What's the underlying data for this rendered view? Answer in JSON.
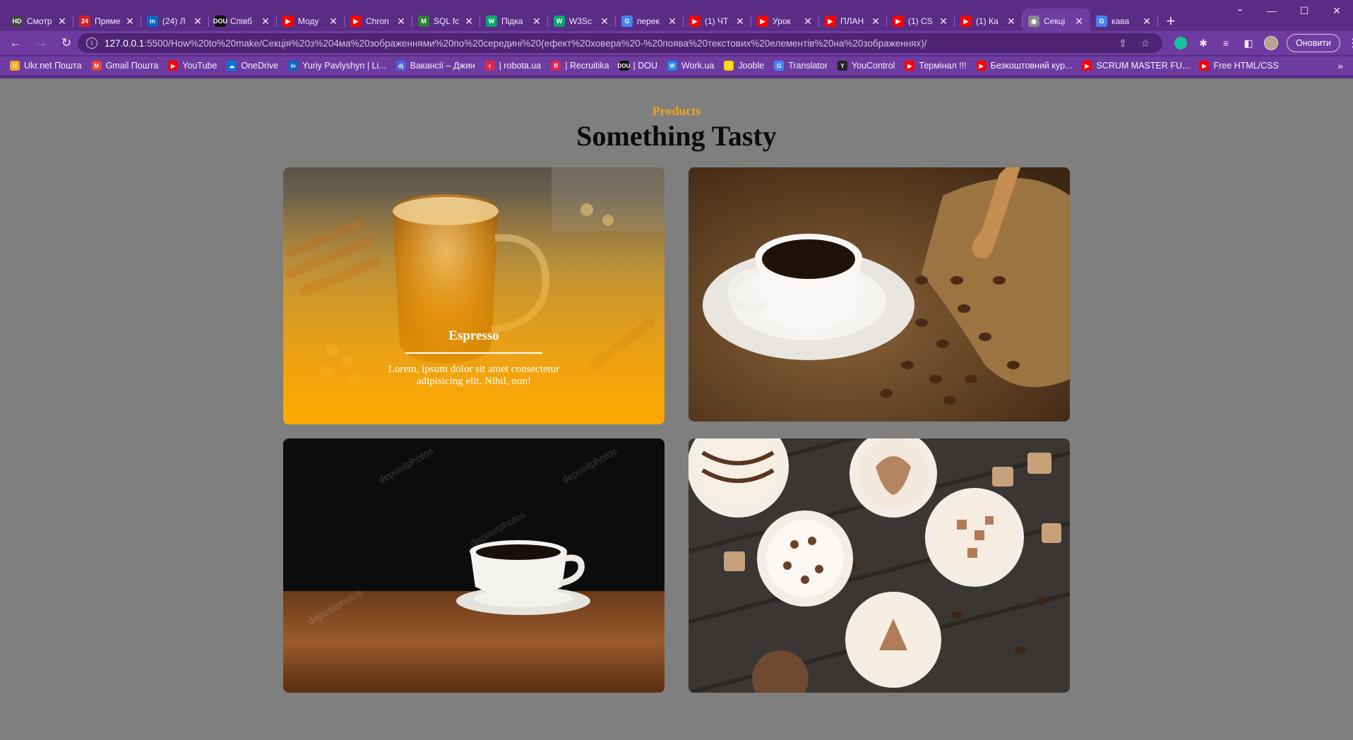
{
  "browser": {
    "tabs": [
      {
        "title": "Смотр",
        "icon_color": "#444444",
        "icon_text": "HD"
      },
      {
        "title": "Пряме",
        "icon_color": "#d32027",
        "icon_text": "24"
      },
      {
        "title": "(24) Л",
        "icon_color": "#0a66c2",
        "icon_text": "in"
      },
      {
        "title": "Співб",
        "icon_color": "#111111",
        "icon_text": "DOU"
      },
      {
        "title": "Моду",
        "icon_color": "#ff0000",
        "icon_text": "▶"
      },
      {
        "title": "Chron",
        "icon_color": "#ff0000",
        "icon_text": "▶"
      },
      {
        "title": "SQL fc",
        "icon_color": "#2e7d32",
        "icon_text": "M"
      },
      {
        "title": "Підка",
        "icon_color": "#04aa6d",
        "icon_text": "W"
      },
      {
        "title": "W3Sc",
        "icon_color": "#04aa6d",
        "icon_text": "W"
      },
      {
        "title": "перек",
        "icon_color": "#4285f4",
        "icon_text": "G"
      },
      {
        "title": "(1) ЧТ",
        "icon_color": "#ff0000",
        "icon_text": "▶"
      },
      {
        "title": "Урок",
        "icon_color": "#ff0000",
        "icon_text": "▶"
      },
      {
        "title": "ПЛАН",
        "icon_color": "#ff0000",
        "icon_text": "▶"
      },
      {
        "title": "(1) CS",
        "icon_color": "#ff0000",
        "icon_text": "▶"
      },
      {
        "title": "(1) Ка",
        "icon_color": "#ff0000",
        "icon_text": "▶"
      },
      {
        "title": "Секці",
        "icon_color": "#8a8a8a",
        "icon_text": "◉",
        "active": true
      },
      {
        "title": "кава",
        "icon_color": "#4285f4",
        "icon_text": "G"
      }
    ],
    "new_tab": "+",
    "tab_search": "⌄",
    "win_controls": {
      "minimize": "—",
      "maximize": "☐",
      "close": "✕"
    },
    "nav": {
      "back": "←",
      "forward": "→",
      "reload": "↻"
    },
    "url_host": "127.0.0.1",
    "url_rest": ":5500/How%20to%20make/Секція%20з%204ма%20зображеннями%20по%20середині%20(ефект%20ховера%20-%20поява%20текстових%20елементів%20на%20зображеннях)/",
    "update_label": "Оновити",
    "bookmarks": [
      {
        "label": "Ukr.net Пошта",
        "icon_color": "#f5a623",
        "icon_text": "U"
      },
      {
        "label": "Gmail Пошта",
        "icon_color": "#ea4335",
        "icon_text": "M"
      },
      {
        "label": "YouTube",
        "icon_color": "#ff0000",
        "icon_text": "▶"
      },
      {
        "label": "OneDrive",
        "icon_color": "#0078d4",
        "icon_text": "☁"
      },
      {
        "label": "Yuriy Pavlyshyn | Li...",
        "icon_color": "#0a66c2",
        "icon_text": "in"
      },
      {
        "label": "Вакансії – Джин",
        "icon_color": "#4a63d6",
        "icon_text": "dj"
      },
      {
        "label": "| robota.ua",
        "icon_color": "#e2264d",
        "icon_text": "r"
      },
      {
        "label": "| Recruitika",
        "icon_color": "#e2264d",
        "icon_text": "R"
      },
      {
        "label": "| DOU",
        "icon_color": "#111111",
        "icon_text": "DOU"
      },
      {
        "label": "Work.ua",
        "icon_color": "#1e88e5",
        "icon_text": "W"
      },
      {
        "label": "Jooble",
        "icon_color": "#ffd500",
        "icon_text": "J"
      },
      {
        "label": "Translator",
        "icon_color": "#4285f4",
        "icon_text": "G"
      },
      {
        "label": "YouControl",
        "icon_color": "#222222",
        "icon_text": "Y"
      },
      {
        "label": "Термінал !!!",
        "icon_color": "#ff0000",
        "icon_text": "▶"
      },
      {
        "label": "Безкоштовний кур...",
        "icon_color": "#ff0000",
        "icon_text": "▶"
      },
      {
        "label": "SCRUM MASTER FU...",
        "icon_color": "#ff0000",
        "icon_text": "▶"
      },
      {
        "label": "Free HTML/CSS",
        "icon_color": "#ff0000",
        "icon_text": "▶"
      }
    ],
    "bookmarks_more": "»"
  },
  "page": {
    "subtitle": "Products",
    "heading": "Something Tasty",
    "cards": [
      {
        "title": "Espresso",
        "text": "Lorem, ipsum dolor sit amet consectetur adipisicing elit. Nihil, non!"
      }
    ],
    "watermark": "depositphotos",
    "colors": {
      "background": "#7f7f7f",
      "accent": "#f0a31c",
      "overlay": "#ffa800"
    }
  }
}
